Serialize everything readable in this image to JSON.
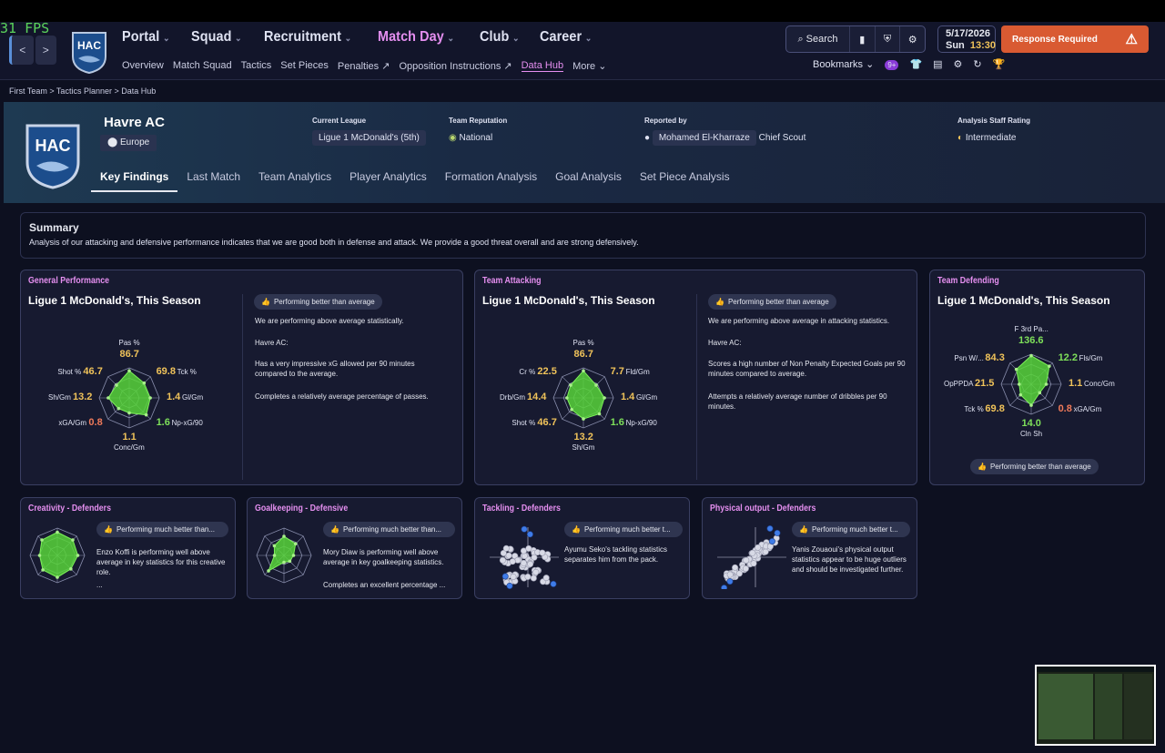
{
  "fps": "31 FPS",
  "nav": {
    "back": "<",
    "forward": ">",
    "main": [
      {
        "label": "Portal"
      },
      {
        "label": "Squad"
      },
      {
        "label": "Recruitment"
      },
      {
        "label": "Match Day"
      },
      {
        "label": "Club"
      },
      {
        "label": "Career"
      }
    ],
    "sub": [
      "Overview",
      "Match Squad",
      "Tactics",
      "Set Pieces",
      "Penalties",
      "Opposition Instructions",
      "Data Hub",
      "More"
    ],
    "search": "Search",
    "bookmarks": "Bookmarks",
    "badge": "9+",
    "date": "5/17/2026",
    "day": "Sun",
    "time": "13:30",
    "response": "Response Required"
  },
  "breadcrumb": "First Team  >  Tactics Planner  >  Data Hub",
  "club": {
    "name": "Havre AC",
    "logo_text": "HAC",
    "region": "Europe",
    "current_league_label": "Current League",
    "current_league": "Ligue 1 McDonald's  (5th)",
    "reputation_label": "Team Reputation",
    "reputation": "National",
    "reported_by_label": "Reported by",
    "reporter": "Mohamed El-Kharraze",
    "reporter_role": "Chief Scout",
    "staff_rating_label": "Analysis Staff Rating",
    "staff_rating": "Intermediate"
  },
  "tabs": [
    "Key Findings",
    "Last Match",
    "Team Analytics",
    "Player Analytics",
    "Formation Analysis",
    "Goal Analysis",
    "Set Piece Analysis"
  ],
  "summary": {
    "title": "Summary",
    "text": "Analysis of our attacking and defensive performance indicates that we are good both in defense and attack. We provide a good threat overall and are strong defensively."
  },
  "general": {
    "title": "General Performance",
    "league": "Ligue 1 McDonald's, This Season",
    "pill": "Performing better than average",
    "lines": [
      "We are performing above average statistically.",
      "Havre AC:",
      "Has a very impressive xG allowed per 90 minutes compared to the average.",
      "Completes a relatively average percentage of passes."
    ],
    "radar": [
      {
        "label": "Pas %",
        "value": "86.7",
        "color": "y"
      },
      {
        "label": "Tck %",
        "value": "69.8",
        "color": "y"
      },
      {
        "label": "Gl/Gm",
        "value": "1.4",
        "color": "y"
      },
      {
        "label": "Np-xG/90",
        "value": "1.6",
        "color": "g"
      },
      {
        "label": "Conc/Gm",
        "value": "1.1",
        "color": "y"
      },
      {
        "label": "xGA/Gm",
        "value": "0.8",
        "color": "r"
      },
      {
        "label": "Sh/Gm",
        "value": "13.2",
        "color": "y"
      },
      {
        "label": "Shot %",
        "value": "46.7",
        "color": "y"
      }
    ]
  },
  "attacking": {
    "title": "Team Attacking",
    "league": "Ligue 1 McDonald's, This Season",
    "pill": "Performing better than average",
    "lines": [
      "We are performing above average in attacking statistics.",
      "Havre AC:",
      "Scores a high number of Non Penalty Expected Goals per 90 minutes compared to average.",
      "Attempts a relatively average number of dribbles per 90 minutes."
    ],
    "radar": [
      {
        "label": "Pas %",
        "value": "86.7",
        "color": "y"
      },
      {
        "label": "Fld/Gm",
        "value": "7.7",
        "color": "y"
      },
      {
        "label": "Gl/Gm",
        "value": "1.4",
        "color": "y"
      },
      {
        "label": "Np-xG/90",
        "value": "1.6",
        "color": "g"
      },
      {
        "label": "Sh/Gm",
        "value": "13.2",
        "color": "y"
      },
      {
        "label": "Shot %",
        "value": "46.7",
        "color": "y"
      },
      {
        "label": "Drb/Gm",
        "value": "14.4",
        "color": "y"
      },
      {
        "label": "Cr %",
        "value": "22.5",
        "color": "y"
      }
    ]
  },
  "defending": {
    "title": "Team Defending",
    "league": "Ligue 1 McDonald's, This Season",
    "pill": "Performing better than average",
    "radar": [
      {
        "label": "F 3rd Pa...",
        "value": "136.6",
        "color": "g"
      },
      {
        "label": "Fls/Gm",
        "value": "12.2",
        "color": "g"
      },
      {
        "label": "Conc/Gm",
        "value": "1.1",
        "color": "y"
      },
      {
        "label": "xGA/Gm",
        "value": "0.8",
        "color": "r"
      },
      {
        "label": "Cln Sh",
        "value": "14.0",
        "color": "g"
      },
      {
        "label": "Tck %",
        "value": "69.8",
        "color": "y"
      },
      {
        "label": "OpPPDA",
        "value": "21.5",
        "color": "y"
      },
      {
        "label": "Psn W/...",
        "value": "84.3",
        "color": "y"
      }
    ]
  },
  "small_cards": [
    {
      "title": "Creativity - Defenders",
      "pill": "Performing much better than...",
      "lines": [
        "Enzo Koffi is performing well above average in key statistics for this creative role.",
        "..."
      ]
    },
    {
      "title": "Goalkeeping - Defensive",
      "pill": "Performing much better than...",
      "lines": [
        "Mory Diaw is performing well above average in key goalkeeping statistics.",
        "Completes an excellent percentage ..."
      ]
    },
    {
      "title": "Tackling - Defenders",
      "pill": "Performing much better t...",
      "lines": [
        "Ayumu Seko's tackling statistics separates him from the pack."
      ]
    },
    {
      "title": "Physical output - Defenders",
      "pill": "Performing much better t...",
      "lines": [
        "Yanis Zouaoui's physical output statistics appear to be huge outliers and should be investigated further."
      ]
    }
  ],
  "colors": {
    "accent": "#e58ff0",
    "radar_fill": "#57d33a",
    "warning": "#d95a32"
  }
}
